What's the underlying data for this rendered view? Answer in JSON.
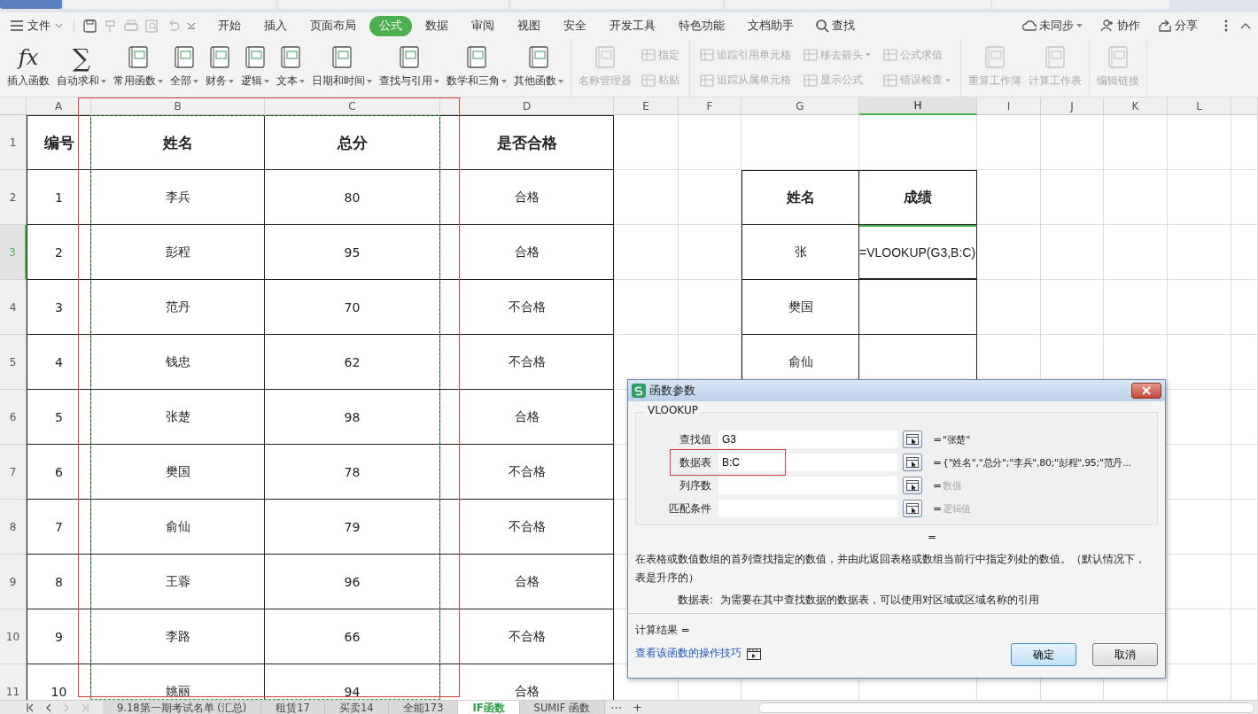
{
  "document_tabs": [
    {
      "selected": true
    },
    {
      "selected": false
    },
    {
      "selected": false
    },
    {
      "selected": false
    },
    {
      "selected": false
    },
    {
      "selected": false
    }
  ],
  "menu": {
    "file": "文件",
    "tabs": [
      {
        "label": "开始",
        "selected": false
      },
      {
        "label": "插入",
        "selected": false
      },
      {
        "label": "页面布局",
        "selected": false
      },
      {
        "label": "公式",
        "selected": true
      },
      {
        "label": "数据",
        "selected": false
      },
      {
        "label": "审阅",
        "selected": false
      },
      {
        "label": "视图",
        "selected": false
      },
      {
        "label": "安全",
        "selected": false
      },
      {
        "label": "开发工具",
        "selected": false
      },
      {
        "label": "特色功能",
        "selected": false
      },
      {
        "label": "文档助手",
        "selected": false
      }
    ],
    "search": "查找",
    "right": [
      {
        "label": "未同步",
        "has_menu": true
      },
      {
        "label": "协作",
        "has_menu": false
      },
      {
        "label": "分享",
        "has_menu": false
      }
    ]
  },
  "ribbon": {
    "groups": [
      {
        "items": [
          {
            "kind": "large",
            "glyph": "fx",
            "label": "插入函数",
            "has_menu": false,
            "disabled": false
          },
          {
            "kind": "large",
            "glyph": "∑",
            "label": "自动求和",
            "has_menu": true,
            "disabled": false
          },
          {
            "kind": "large",
            "label": "常用函数",
            "has_menu": true,
            "disabled": false
          },
          {
            "kind": "large",
            "label": "全部",
            "has_menu": true,
            "disabled": false
          },
          {
            "kind": "large",
            "label": "财务",
            "has_menu": true,
            "disabled": false
          },
          {
            "kind": "large",
            "label": "逻辑",
            "has_menu": true,
            "disabled": false
          },
          {
            "kind": "large",
            "label": "文本",
            "has_menu": true,
            "disabled": false
          },
          {
            "kind": "large",
            "label": "日期和时间",
            "has_menu": true,
            "disabled": false
          },
          {
            "kind": "large",
            "label": "查找与引用",
            "has_menu": true,
            "disabled": false
          },
          {
            "kind": "large",
            "label": "数学和三角",
            "has_menu": true,
            "disabled": false
          },
          {
            "kind": "large",
            "label": "其他函数",
            "has_menu": true,
            "disabled": false
          }
        ]
      },
      {
        "items": [
          {
            "kind": "large",
            "label": "名称管理器",
            "has_menu": false,
            "disabled": true
          },
          {
            "kind": "stack",
            "items": [
              {
                "label": "指定",
                "has_menu": false,
                "disabled": true
              },
              {
                "label": "粘贴",
                "has_menu": false,
                "disabled": true
              }
            ]
          }
        ]
      },
      {
        "items": [
          {
            "kind": "stack",
            "items": [
              {
                "label": "追踪引用单元格",
                "has_menu": false,
                "disabled": true
              },
              {
                "label": "追踪从属单元格",
                "has_menu": false,
                "disabled": true
              }
            ]
          },
          {
            "kind": "stack",
            "items": [
              {
                "label": "移去箭头",
                "has_menu": true,
                "disabled": true
              },
              {
                "label": "显示公式",
                "has_menu": false,
                "disabled": true
              }
            ]
          },
          {
            "kind": "stack",
            "items": [
              {
                "label": "公式求值",
                "has_menu": false,
                "disabled": true
              },
              {
                "label": "错误检查",
                "has_menu": true,
                "disabled": true
              }
            ]
          }
        ]
      },
      {
        "items": [
          {
            "kind": "large",
            "label": "重算工作簿",
            "has_menu": false,
            "disabled": true
          },
          {
            "kind": "large",
            "label": "计算工作表",
            "has_menu": false,
            "disabled": true
          }
        ]
      },
      {
        "items": [
          {
            "kind": "large",
            "label": "编辑链接",
            "has_menu": false,
            "disabled": true
          }
        ]
      }
    ]
  },
  "sheet": {
    "columns": [
      {
        "label": "A",
        "selected": false
      },
      {
        "label": "B",
        "selected": false
      },
      {
        "label": "C",
        "selected": false
      },
      {
        "label": "D",
        "selected": false
      },
      {
        "label": "E",
        "selected": false
      },
      {
        "label": "F",
        "selected": false
      },
      {
        "label": "G",
        "selected": false
      },
      {
        "label": "H",
        "selected": true
      },
      {
        "label": "I",
        "selected": false
      },
      {
        "label": "J",
        "selected": false
      },
      {
        "label": "K",
        "selected": false
      },
      {
        "label": "L",
        "selected": false
      }
    ],
    "rows": [
      {
        "label": "1",
        "selected": false
      },
      {
        "label": "2",
        "selected": false
      },
      {
        "label": "3",
        "selected": true
      },
      {
        "label": "4",
        "selected": false
      },
      {
        "label": "5",
        "selected": false
      },
      {
        "label": "6",
        "selected": false
      },
      {
        "label": "7",
        "selected": false
      },
      {
        "label": "8",
        "selected": false
      },
      {
        "label": "9",
        "selected": false
      },
      {
        "label": "10",
        "selected": false
      },
      {
        "label": "11",
        "selected": false
      }
    ],
    "table": {
      "headers": [
        "编号",
        "姓名",
        "总分",
        "是否合格"
      ],
      "rows": [
        [
          "1",
          "李兵",
          "80",
          "合格"
        ],
        [
          "2",
          "彭程",
          "95",
          "合格"
        ],
        [
          "3",
          "范丹",
          "70",
          "不合格"
        ],
        [
          "4",
          "钱忠",
          "62",
          "不合格"
        ],
        [
          "5",
          "张楚",
          "98",
          "合格"
        ],
        [
          "6",
          "樊国",
          "78",
          "不合格"
        ],
        [
          "7",
          "俞仙",
          "79",
          "不合格"
        ],
        [
          "8",
          "王蓉",
          "96",
          "合格"
        ],
        [
          "9",
          "李路",
          "66",
          "不合格"
        ],
        [
          "10",
          "姚丽",
          "94",
          "合格"
        ]
      ]
    },
    "lookup": {
      "headers": [
        "姓名",
        "成绩"
      ],
      "names": [
        "张",
        "樊国",
        "俞仙"
      ]
    },
    "active_cell": {
      "text": "=VLOOKUP(G3,B:C)",
      "editing": true
    },
    "highlight_frame": true,
    "copy_marquee": true
  },
  "dialog": {
    "title": "函数参数",
    "function": "VLOOKUP",
    "params": [
      {
        "label": "查找值",
        "value": "G3",
        "sign": "=",
        "result": "\"张楚\"",
        "greyed": false,
        "highlighted": false
      },
      {
        "label": "数据表",
        "value": "B:C",
        "sign": "=",
        "result": "{\"姓名\",\"总分\";\"李兵\",80;\"彭程\",95;\"范丹...",
        "greyed": false,
        "highlighted": true
      },
      {
        "label": "列序数",
        "sign": "=",
        "result": "数值",
        "greyed": true,
        "highlighted": false
      },
      {
        "label": "匹配条件",
        "sign": "=",
        "result": "逻辑值",
        "greyed": true,
        "highlighted": false
      }
    ],
    "formula_result": "=",
    "description": "在表格或数值数组的首列查找指定的数值，并由此返回表格或数组当前行中指定列处的数值。（默认情况下，表是升序的）",
    "param_help": {
      "label": "数据表:",
      "text": "为需要在其中查找数据的数据表，可以使用对区域或区域名称的引用"
    },
    "calc_result": "计算结果  =",
    "link": "查看该函数的操作技巧",
    "buttons": [
      {
        "label": "确定",
        "default": true
      },
      {
        "label": "取消",
        "default": false
      }
    ]
  },
  "sheet_tabs": {
    "tabs": [
      {
        "label": "9.18第一期考试名单 (汇总)",
        "selected": false
      },
      {
        "label": "租赁17",
        "selected": false
      },
      {
        "label": "买卖14",
        "selected": false
      },
      {
        "label": "全能173",
        "selected": false
      },
      {
        "label": "IF函数",
        "selected": true
      },
      {
        "label": "SUMIF 函数",
        "selected": false
      }
    ],
    "more": "⋯",
    "add": "+"
  }
}
